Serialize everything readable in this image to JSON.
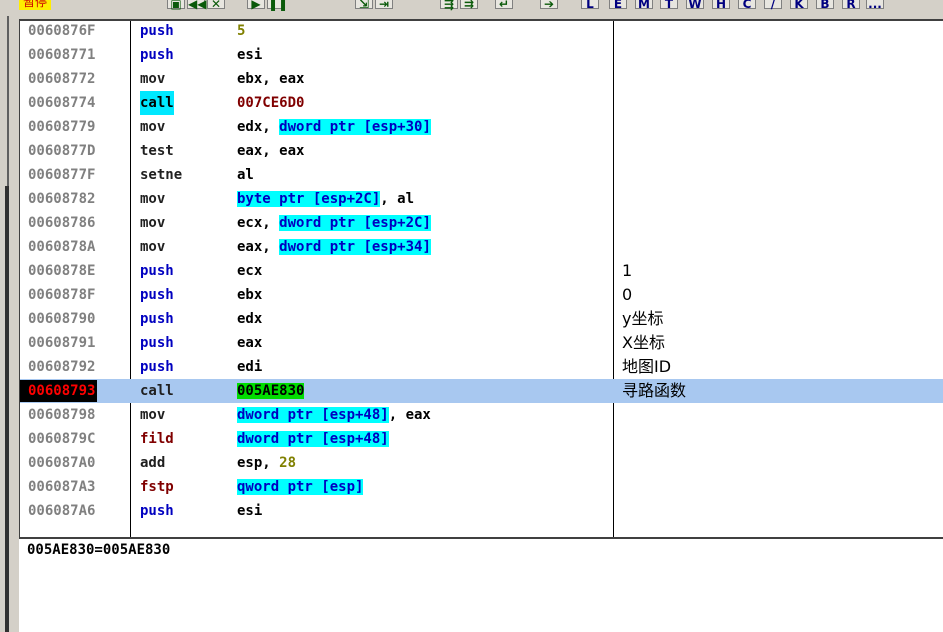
{
  "toolbar": {
    "status": "暂停",
    "letters": [
      "L",
      "E",
      "M",
      "T",
      "W",
      "H",
      "C",
      "/",
      "K",
      "B",
      "R",
      "..."
    ]
  },
  "rows": [
    {
      "addr": "0060876F",
      "mnem": "push",
      "ops": [
        {
          "t": "5",
          "c": "num"
        }
      ],
      "comment": ""
    },
    {
      "addr": "00608771",
      "mnem": "push",
      "ops": [
        {
          "t": "esi"
        }
      ],
      "comment": ""
    },
    {
      "addr": "00608772",
      "mnem": "mov",
      "ops": [
        {
          "t": "ebx, eax"
        }
      ],
      "comment": ""
    },
    {
      "addr": "00608774",
      "mnem": "call",
      "ops": [
        {
          "t": "007CE6D0",
          "c": "addr"
        }
      ],
      "comment": ""
    },
    {
      "addr": "00608779",
      "mnem": "mov",
      "ops": [
        {
          "t": "edx, "
        },
        {
          "t": "dword ptr [esp+30]",
          "c": "cyan"
        }
      ],
      "comment": ""
    },
    {
      "addr": "0060877D",
      "mnem": "test",
      "ops": [
        {
          "t": "eax, eax"
        }
      ],
      "comment": ""
    },
    {
      "addr": "0060877F",
      "mnem": "setne",
      "ops": [
        {
          "t": "al"
        }
      ],
      "comment": ""
    },
    {
      "addr": "00608782",
      "mnem": "mov",
      "ops": [
        {
          "t": "byte ptr [esp+2C]",
          "c": "cyan"
        },
        {
          "t": ", al"
        }
      ],
      "comment": ""
    },
    {
      "addr": "00608786",
      "mnem": "mov",
      "ops": [
        {
          "t": "ecx, "
        },
        {
          "t": "dword ptr [esp+2C]",
          "c": "cyan"
        }
      ],
      "comment": ""
    },
    {
      "addr": "0060878A",
      "mnem": "mov",
      "ops": [
        {
          "t": "eax, "
        },
        {
          "t": "dword ptr [esp+34]",
          "c": "cyan"
        }
      ],
      "comment": ""
    },
    {
      "addr": "0060878E",
      "mnem": "push",
      "ops": [
        {
          "t": "ecx"
        }
      ],
      "comment": "1"
    },
    {
      "addr": "0060878F",
      "mnem": "push",
      "ops": [
        {
          "t": "ebx"
        }
      ],
      "comment": "0"
    },
    {
      "addr": "00608790",
      "mnem": "push",
      "ops": [
        {
          "t": "edx"
        }
      ],
      "comment": "y坐标"
    },
    {
      "addr": "00608791",
      "mnem": "push",
      "ops": [
        {
          "t": "eax"
        }
      ],
      "comment": "X坐标"
    },
    {
      "addr": "00608792",
      "mnem": "push",
      "ops": [
        {
          "t": "edi"
        }
      ],
      "comment": "地图ID"
    },
    {
      "addr": "00608793",
      "mnem": "call",
      "ops": [
        {
          "t": "005AE830",
          "c": "green"
        }
      ],
      "comment": "寻路函数",
      "selected": true,
      "current": true
    },
    {
      "addr": "00608798",
      "mnem": "mov",
      "ops": [
        {
          "t": "dword ptr [esp+48]",
          "c": "cyan"
        },
        {
          "t": ", eax"
        }
      ],
      "comment": ""
    },
    {
      "addr": "0060879C",
      "mnem": "fild",
      "ops": [
        {
          "t": "dword ptr [esp+48]",
          "c": "cyan"
        }
      ],
      "comment": ""
    },
    {
      "addr": "006087A0",
      "mnem": "add",
      "ops": [
        {
          "t": "esp, "
        },
        {
          "t": "28",
          "c": "num"
        }
      ],
      "comment": ""
    },
    {
      "addr": "006087A3",
      "mnem": "fstp",
      "ops": [
        {
          "t": "qword ptr [esp]",
          "c": "cyan"
        }
      ],
      "comment": ""
    },
    {
      "addr": "006087A6",
      "mnem": "push",
      "ops": [
        {
          "t": "esi"
        }
      ],
      "comment": ""
    }
  ],
  "info": {
    "text": "005AE830=005AE830"
  }
}
